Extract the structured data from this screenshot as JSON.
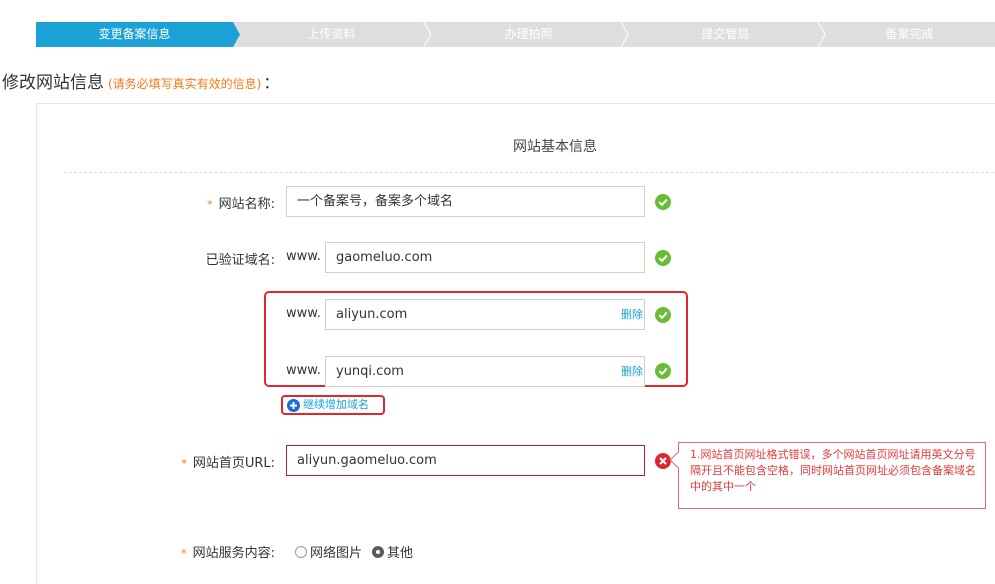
{
  "steps": [
    {
      "label": "变更备案信息",
      "active": true
    },
    {
      "label": "上传资料",
      "active": false
    },
    {
      "label": "办理拍照",
      "active": false
    },
    {
      "label": "提交管局",
      "active": false
    },
    {
      "label": "备案完成",
      "active": false
    }
  ],
  "heading": {
    "title": "修改网站信息",
    "hint": "(请务必填写真实有效的信息)",
    "colon": "："
  },
  "section_title": "网站基本信息",
  "form": {
    "required_mark": "*",
    "site_name": {
      "label": "网站名称:",
      "value": "一个备案号，备案多个域名",
      "status": "ok"
    },
    "verified_domain": {
      "label": "已验证域名:",
      "prefix": "www.",
      "value": "gaomeluo.com",
      "status": "ok"
    },
    "extra_domains": [
      {
        "prefix": "www.",
        "value": "aliyun.com",
        "delete_label": "删除",
        "status": "ok"
      },
      {
        "prefix": "www.",
        "value": "yunqi.com",
        "delete_label": "删除",
        "status": "ok"
      }
    ],
    "add_domain_label": "继续增加域名",
    "homepage_url": {
      "label": "网站首页URL:",
      "value": "aliyun.gaomeluo.com",
      "status": "error",
      "error_message": "1.网站首页网址格式错误，多个网站首页网址请用英文分号隔开且不能包含空格，同时网站首页网址必须包含备案域名中的其中一个"
    },
    "service_content": {
      "label": "网站服务内容:",
      "options": [
        {
          "label": "网络图片",
          "checked": false
        },
        {
          "label": "其他",
          "checked": true
        }
      ]
    }
  },
  "colors": {
    "accent": "#1ba1d6",
    "step_inactive": "#dedede",
    "required": "#f27b1b",
    "ok": "#69bd33",
    "error": "#d9292b",
    "highlight": "#e3262b"
  }
}
